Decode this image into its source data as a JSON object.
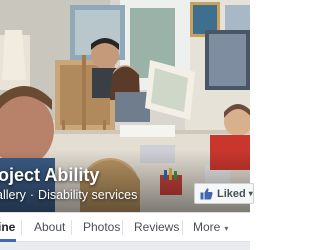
{
  "page": {
    "title": "oject Ability",
    "categories": [
      "allery",
      "Disability services"
    ],
    "category_separator": "·"
  },
  "like_button": {
    "label": "Liked",
    "icon": "thumbs-up-icon",
    "caret": "▾"
  },
  "tabs": [
    {
      "label": "ine",
      "active": true
    },
    {
      "label": "About",
      "active": false
    },
    {
      "label": "Photos",
      "active": false
    },
    {
      "label": "Reviews",
      "active": false
    },
    {
      "label": "More",
      "active": false
    }
  ],
  "more_caret": "▾",
  "colors": {
    "accent": "#4267b2",
    "tab_border": "#dddfe2",
    "button_bg": "#f6f7f9",
    "cover_wall": "#d9d6cf"
  }
}
